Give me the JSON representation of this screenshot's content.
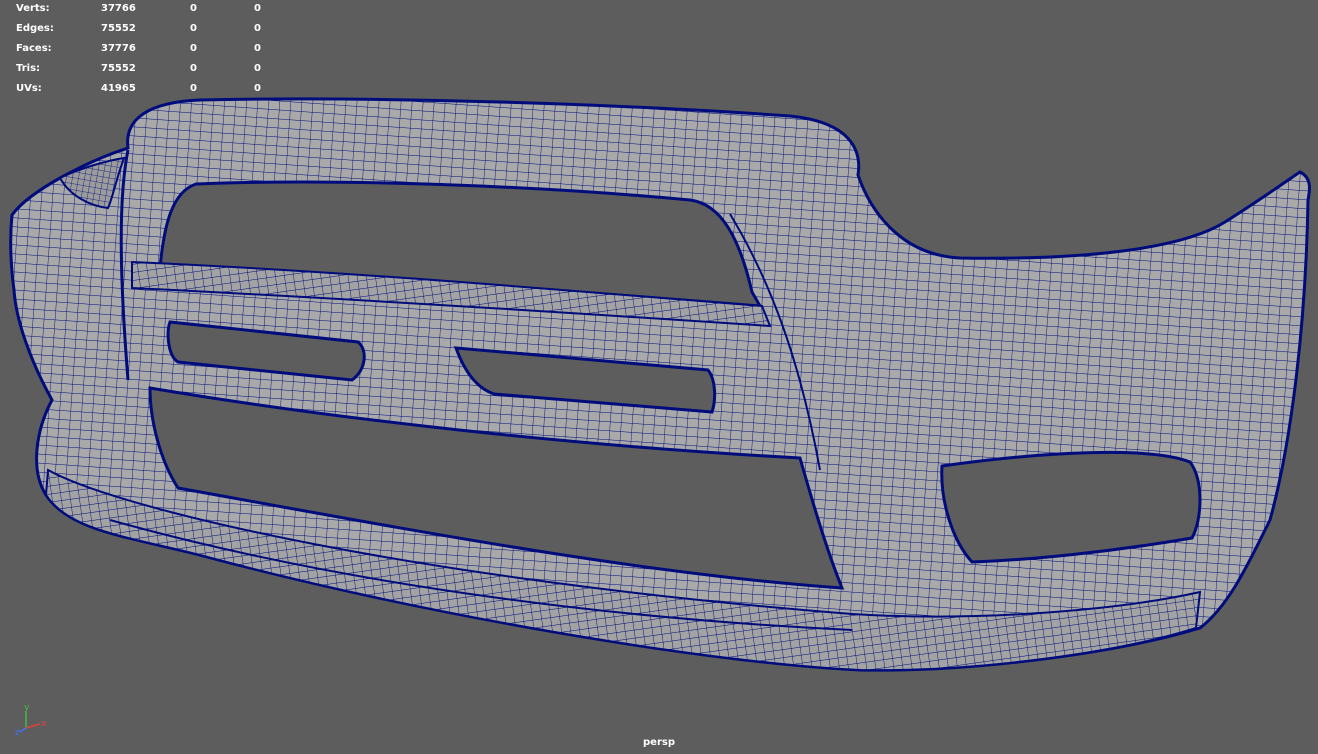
{
  "heads_up": {
    "rows": [
      {
        "label": "Verts:",
        "values": [
          "37766",
          "0",
          "0"
        ]
      },
      {
        "label": "Edges:",
        "values": [
          "75552",
          "0",
          "0"
        ]
      },
      {
        "label": "Faces:",
        "values": [
          "37776",
          "0",
          "0"
        ]
      },
      {
        "label": "Tris:",
        "values": [
          "75552",
          "0",
          "0"
        ]
      },
      {
        "label": "UVs:",
        "values": [
          "41965",
          "0",
          "0"
        ]
      }
    ]
  },
  "viewport": {
    "camera": "persp",
    "background_color": "#5d5d5d",
    "wireframe_color": "#000c7c",
    "surface_color": "#a8a8a8"
  },
  "axis_gizmo": {
    "x": "x",
    "y": "y",
    "z": "z",
    "x_color": "#e04040",
    "y_color": "#40c040",
    "z_color": "#4070ff"
  }
}
